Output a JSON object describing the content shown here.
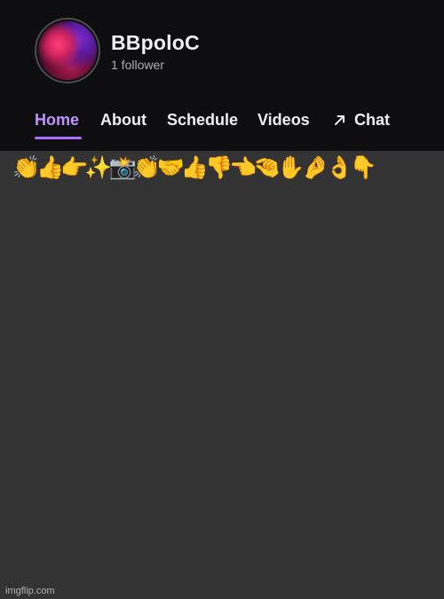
{
  "channel": {
    "name": "BBpoloC",
    "followers": "1 follower"
  },
  "tabs": [
    {
      "label": "Home",
      "active": true
    },
    {
      "label": "About",
      "active": false
    },
    {
      "label": "Schedule",
      "active": false
    },
    {
      "label": "Videos",
      "active": false
    },
    {
      "label": "Chat",
      "active": false,
      "icon": "arrow-up-right-icon"
    }
  ],
  "emoji_banner": "👏👍👉✨📸👏🤝👍👎👈🤏✋🤌👌👇",
  "watermark": "imgflip.com",
  "colors": {
    "header_bg": "#0e0e10",
    "page_bg": "#333333",
    "accent": "#a970ff",
    "active_tab": "#bf94ff"
  }
}
